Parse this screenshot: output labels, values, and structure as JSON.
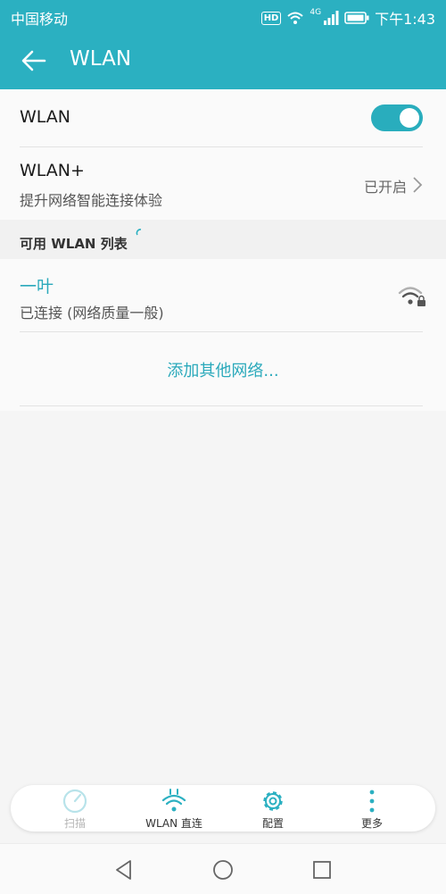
{
  "status": {
    "carrier": "中国移动",
    "hd": "HD",
    "network": "4G",
    "time": "下午1:43"
  },
  "header": {
    "title": "WLAN"
  },
  "wlan_row": {
    "label": "WLAN",
    "enabled": true
  },
  "wlan_plus": {
    "label": "WLAN+",
    "description": "提升网络智能连接体验",
    "value": "已开启"
  },
  "list": {
    "header": "可用 WLAN 列表",
    "networks": [
      {
        "name": "一叶",
        "status": "已连接 (网络质量一般)"
      }
    ],
    "add_other": "添加其他网络..."
  },
  "bottom_bar": {
    "scan": "扫描",
    "wlan_direct": "WLAN 直连",
    "config": "配置",
    "more": "更多"
  },
  "colors": {
    "accent": "#2bb0c1",
    "link": "#2aa9bb"
  }
}
